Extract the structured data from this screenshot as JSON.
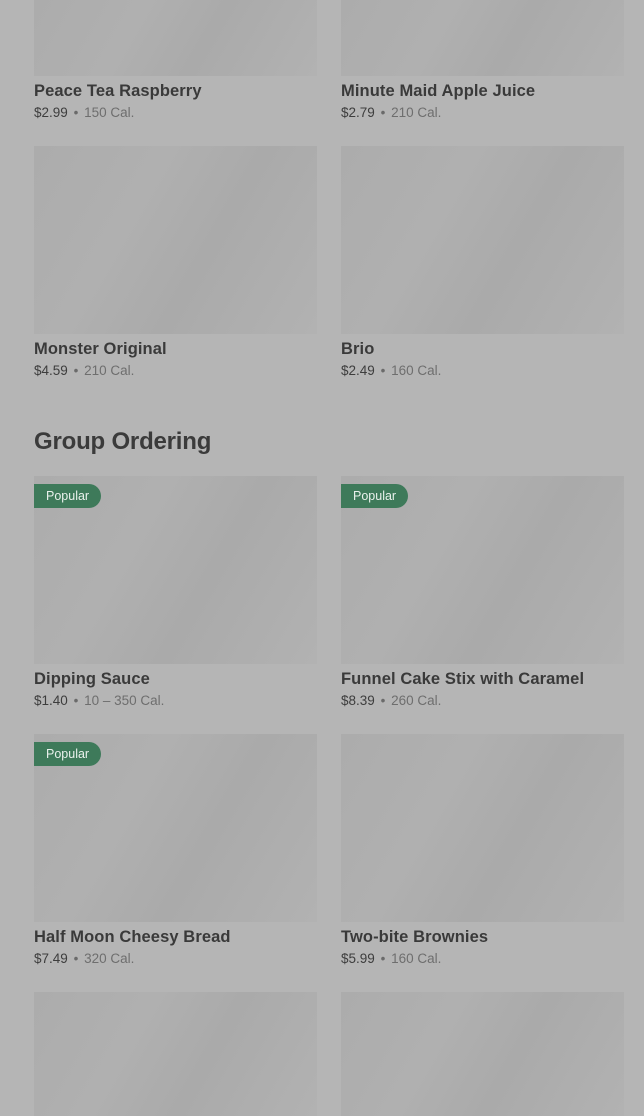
{
  "drinks_partial": [
    {
      "name": "Peace Tea Raspberry",
      "price": "$2.99",
      "sep": "•",
      "calories": "150 Cal."
    },
    {
      "name": "Minute Maid Apple Juice",
      "price": "$2.79",
      "sep": "•",
      "calories": "210 Cal."
    }
  ],
  "drinks": [
    {
      "name": "Monster Original",
      "price": "$4.59",
      "sep": "•",
      "calories": "210 Cal."
    },
    {
      "name": "Brio",
      "price": "$2.49",
      "sep": "•",
      "calories": "160 Cal."
    }
  ],
  "group_ordering": {
    "title": "Group Ordering",
    "items": [
      {
        "name": "Dipping Sauce",
        "badge": "Popular",
        "price": "$1.40",
        "sep": "•",
        "calories": "10 – 350 Cal."
      },
      {
        "name": "Funnel Cake Stix with Caramel",
        "badge": "Popular",
        "price": "$8.39",
        "sep": "•",
        "calories": "260 Cal."
      },
      {
        "name": "Half Moon Cheesy Bread",
        "badge": "Popular",
        "price": "$7.49",
        "sep": "•",
        "calories": "320 Cal."
      },
      {
        "name": "Two-bite Brownies",
        "price": "$5.99",
        "sep": "•",
        "calories": "160 Cal."
      }
    ]
  },
  "colors": {
    "background": "#b5b5b5",
    "badge": "#3e7a5a",
    "text": "#3a3a3a"
  }
}
